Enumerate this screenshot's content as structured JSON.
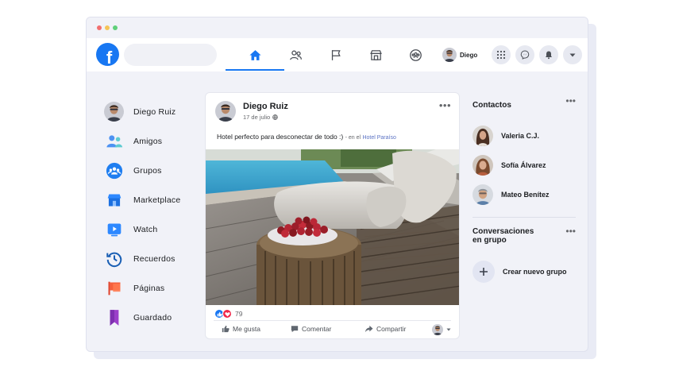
{
  "user": {
    "name": "Diego"
  },
  "search": {
    "placeholder": ""
  },
  "nav_tabs": [
    {
      "name": "home",
      "active": true
    },
    {
      "name": "friends",
      "active": false
    },
    {
      "name": "pages",
      "active": false
    },
    {
      "name": "marketplace",
      "active": false
    },
    {
      "name": "groups",
      "active": false
    }
  ],
  "left_nav": {
    "items": [
      {
        "label": "Diego Ruiz",
        "icon": "avatar"
      },
      {
        "label": "Amigos",
        "icon": "friends-icon"
      },
      {
        "label": "Grupos",
        "icon": "groups-icon"
      },
      {
        "label": "Marketplace",
        "icon": "marketplace-icon"
      },
      {
        "label": "Watch",
        "icon": "watch-icon"
      },
      {
        "label": "Recuerdos",
        "icon": "memories-icon"
      },
      {
        "label": "Páginas",
        "icon": "pages-flag-icon"
      },
      {
        "label": "Guardado",
        "icon": "saved-bookmark-icon"
      }
    ]
  },
  "post": {
    "author": "Diego Ruiz",
    "date": "17 de julio",
    "text": "Hotel perfecto para desconectar de todo :)",
    "separator": "- en el",
    "location": "Hotel Paraíso",
    "reaction_count": "79",
    "actions": {
      "like": "Me gusta",
      "comment": "Comentar",
      "share": "Compartir"
    }
  },
  "contacts": {
    "title": "Contactos",
    "items": [
      {
        "name": "Valeria C.J."
      },
      {
        "name": "Sofía Álvarez"
      },
      {
        "name": "Mateo Benítez"
      }
    ]
  },
  "group_conversations": {
    "title_line1": "Conversaciones",
    "title_line2": "en grupo",
    "create_label": "Crear nuevo grupo"
  },
  "colors": {
    "brand": "#1877f2",
    "link": "#5c73c4",
    "background": "#f1f2f8"
  }
}
